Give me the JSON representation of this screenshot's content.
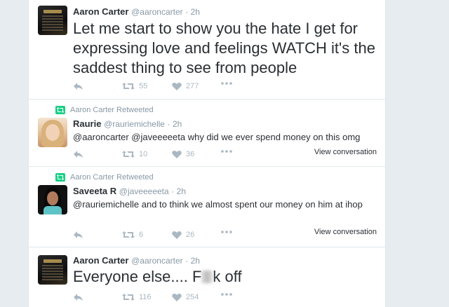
{
  "tweets": [
    {
      "name": "Aaron Carter",
      "handle": "@aaroncarter",
      "time": "· 2h",
      "text": "Let me start to show you the hate I get for expressing love and feelings WATCH it's the saddest thing to see from people",
      "retweets": "55",
      "likes": "277"
    },
    {
      "retweeted_by": "Aaron Carter Retweeted",
      "name": "Raurie",
      "handle": "@rauriemichelle",
      "time": "· 2h",
      "text": "@aaroncarter @javeeeeeta why did we ever spend money on this omg",
      "retweets": "10",
      "likes": "36",
      "view_conversation": "View conversation"
    },
    {
      "retweeted_by": "Aaron Carter Retweeted",
      "name": "Saveeta R",
      "handle": "@javeeeeeta",
      "time": "· 2h",
      "text": "@rauriemichelle and to think we almost spent our money on him at ihop",
      "retweets": "6",
      "likes": "26",
      "view_conversation": "View conversation"
    },
    {
      "name": "Aaron Carter",
      "handle": "@aaroncarter",
      "time": "· 2h",
      "text_before": "Everyone else.... F",
      "text_after": "k off",
      "retweets": "116",
      "likes": "254"
    }
  ],
  "icons": {
    "reply": "reply-icon",
    "retweet": "retweet-icon",
    "like": "heart-icon",
    "more": "more-icon"
  },
  "colors": {
    "retweet_badge": "#19cf86",
    "icon_gray": "#aab8c2",
    "handle_gray": "#8899a6"
  }
}
